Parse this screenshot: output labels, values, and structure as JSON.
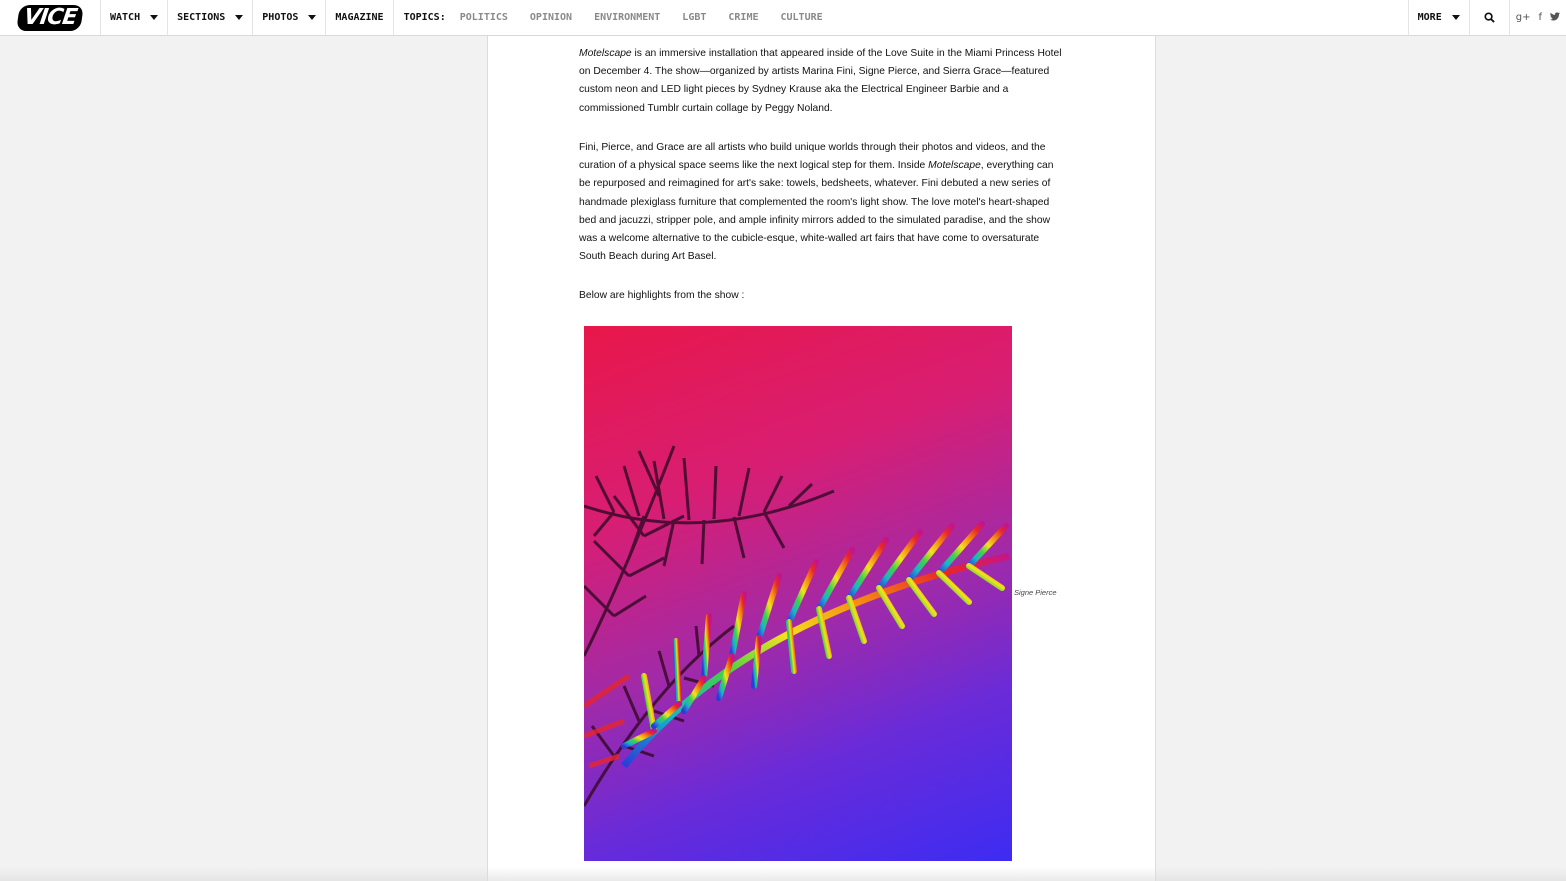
{
  "nav": {
    "logo": "VICE",
    "items": [
      {
        "label": "WATCH",
        "dropdown": true
      },
      {
        "label": "SECTIONS",
        "dropdown": true
      },
      {
        "label": "PHOTOS",
        "dropdown": true
      },
      {
        "label": "MAGAZINE",
        "dropdown": false
      }
    ],
    "topics_label": "TOPICS:",
    "topics": [
      "POLITICS",
      "OPINION",
      "ENVIRONMENT",
      "LGBT",
      "CRIME",
      "CULTURE"
    ],
    "more_label": "MORE",
    "search_icon": "search-icon",
    "social": [
      {
        "icon": "google-plus-icon",
        "glyph": "g+"
      },
      {
        "icon": "facebook-icon",
        "glyph": "f"
      },
      {
        "icon": "twitter-icon",
        "glyph": "t"
      }
    ]
  },
  "article": {
    "p1_em": "Motelscape",
    "p1_rest": " is an immersive installation that appeared inside of the Love Suite in the Miami Princess Hotel on December 4. The show—organized by artists Marina Fini, Signe Pierce, and Sierra Grace—featured custom neon and LED light pieces by Sydney Krause aka the Electrical Engineer Barbie and a commissioned Tumblr curtain collage by Peggy Noland.",
    "p2_a": "Fini, Pierce, and Grace are all artists who build unique worlds through their photos and videos, and the curation of a physical space seems like the next logical step for them. Inside ",
    "p2_em": "Motelscape",
    "p2_b": ", everything can be repurposed and reimagined for art's sake: towels, bedsheets, whatever. Fini debuted a new series of handmade plexiglass furniture that complemented the room's light show. The love motel's heart-shaped bed and jacuzzi, stripper pole, and ample infinity mirrors added to the simulated paradise, and the show was a welcome alternative to the cubicle-esque, white-walled art fairs that have come to oversaturate South Beach during Art Basel.",
    "p3": "Below are highlights from the show :",
    "photo_caption": "Signe Pierce"
  },
  "colors": {
    "photo_top": "#e8174a",
    "photo_bottom": "#3d2cf2",
    "topic_gray": "#8a8a8a"
  }
}
